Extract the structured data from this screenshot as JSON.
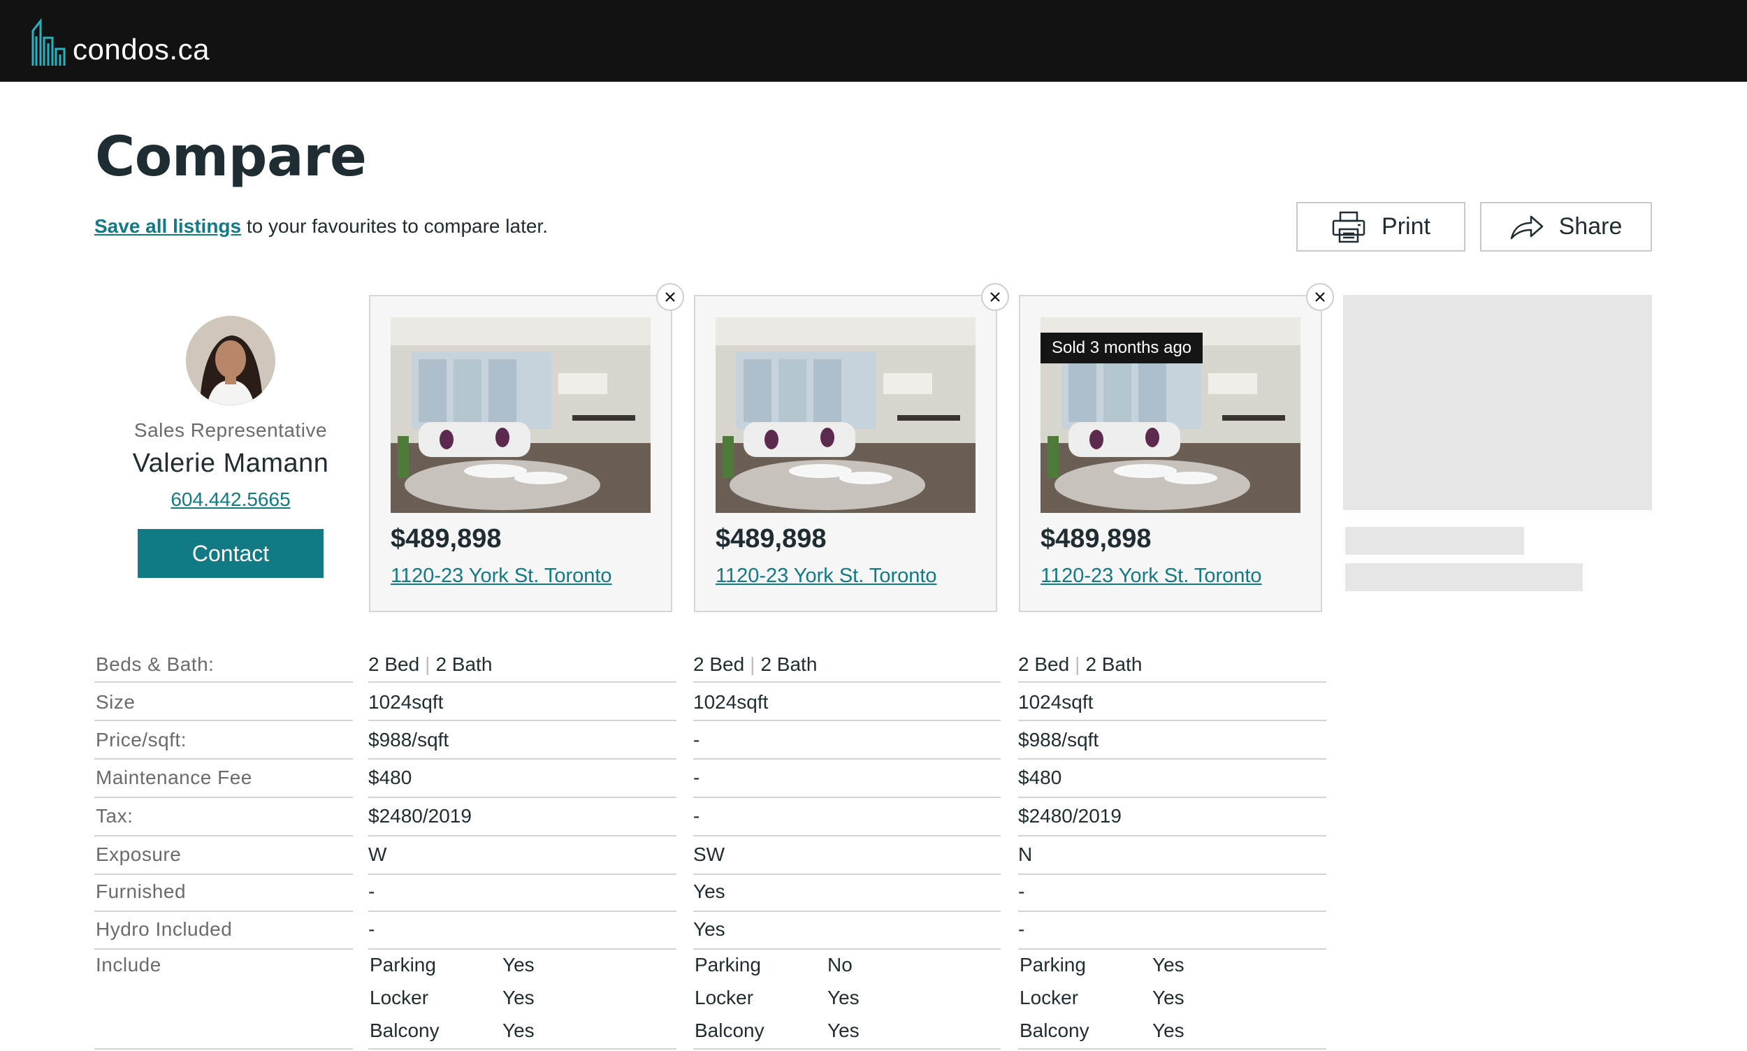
{
  "brand": {
    "name": "condos.ca",
    "accent": "#117a85",
    "logo_icon": "buildings-logo-icon"
  },
  "page": {
    "title": "Compare",
    "save_link": "Save all listings",
    "save_text": " to your favourites to compare later.",
    "print_label": "Print",
    "share_label": "Share"
  },
  "agent": {
    "role": "Sales Representative",
    "name": "Valerie Mamann",
    "phone": "604.442.5665",
    "contact_label": "Contact"
  },
  "listings": [
    {
      "price": "$489,898",
      "address": "1120-23 York St. Toronto",
      "badge": ""
    },
    {
      "price": "$489,898",
      "address": "1120-23 York St. Toronto",
      "badge": ""
    },
    {
      "price": "$489,898",
      "address": "1120-23 York St. Toronto",
      "badge": "Sold 3 months ago"
    }
  ],
  "rows": {
    "labels": [
      "Beds & Bath:",
      "Size",
      "Price/sqft:",
      "Maintenance Fee",
      "Tax:",
      "Exposure",
      "Furnished",
      "Hydro Included",
      "Include"
    ],
    "bed_label": "2 Bed",
    "bath_label": "2 Bath",
    "values": [
      [
        "1024sqft",
        "$988/sqft",
        "$480",
        "$2480/2019",
        "W",
        "-",
        "-"
      ],
      [
        "1024sqft",
        "-",
        "-",
        "-",
        "SW",
        "Yes",
        "Yes"
      ],
      [
        "1024sqft",
        "$988/sqft",
        "$480",
        "$2480/2019",
        "N",
        "-",
        "-"
      ]
    ],
    "include_items": [
      "Parking",
      "Locker",
      "Balcony"
    ],
    "include_values": [
      [
        "Yes",
        "Yes",
        "Yes"
      ],
      [
        "No",
        "Yes",
        "Yes"
      ],
      [
        "Yes",
        "Yes",
        "Yes"
      ]
    ]
  }
}
